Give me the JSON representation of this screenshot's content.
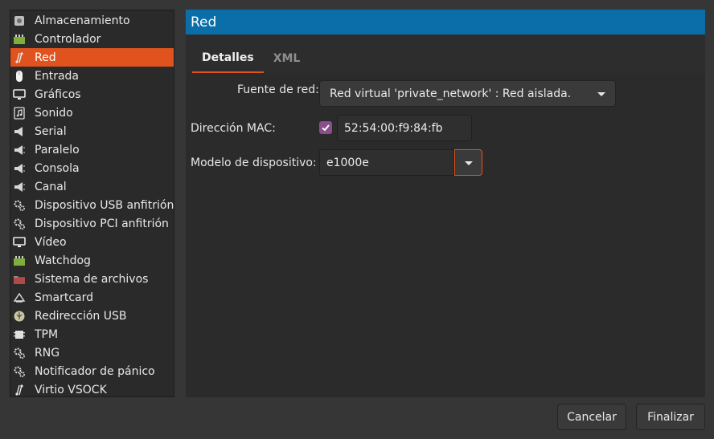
{
  "sidebar": {
    "items": [
      {
        "label": "Almacenamiento",
        "icon": "disk-icon"
      },
      {
        "label": "Controlador",
        "icon": "chip-icon"
      },
      {
        "label": "Red",
        "icon": "network-icon",
        "selected": true
      },
      {
        "label": "Entrada",
        "icon": "mouse-icon"
      },
      {
        "label": "Gráficos",
        "icon": "monitor-icon"
      },
      {
        "label": "Sonido",
        "icon": "sound-icon"
      },
      {
        "label": "Serial",
        "icon": "serial-icon"
      },
      {
        "label": "Paralelo",
        "icon": "port-icon"
      },
      {
        "label": "Consola",
        "icon": "port-icon"
      },
      {
        "label": "Canal",
        "icon": "port-icon"
      },
      {
        "label": "Dispositivo USB anfitrión",
        "icon": "gears-icon"
      },
      {
        "label": "Dispositivo PCI anfitrión",
        "icon": "gears-icon"
      },
      {
        "label": "Vídeo",
        "icon": "monitor-icon"
      },
      {
        "label": "Watchdog",
        "icon": "chip-icon"
      },
      {
        "label": "Sistema de archivos",
        "icon": "folder-icon"
      },
      {
        "label": "Smartcard",
        "icon": "smartcard-icon"
      },
      {
        "label": "Redirección USB",
        "icon": "usb-icon"
      },
      {
        "label": "TPM",
        "icon": "tpm-icon"
      },
      {
        "label": "RNG",
        "icon": "gears-icon"
      },
      {
        "label": "Notificador de pánico",
        "icon": "gears-icon"
      },
      {
        "label": "Virtio VSOCK",
        "icon": "network-icon"
      }
    ]
  },
  "header": {
    "title": "Red"
  },
  "tabs": [
    {
      "label": "Detalles",
      "active": true
    },
    {
      "label": "XML",
      "active": false
    }
  ],
  "form": {
    "source_label": "Fuente de red:",
    "source_value": "Red virtual 'private_network' : Red aislada.",
    "mac_label": "Dirección MAC:",
    "mac_checked": true,
    "mac_value": "52:54:00:f9:84:fb",
    "model_label": "Modelo de dispositivo:",
    "model_value": "e1000e"
  },
  "footer": {
    "cancel_label": "Cancelar",
    "finish_label": "Finalizar"
  },
  "colors": {
    "accent": "#e0531e",
    "header": "#0b6ea8",
    "checkbox": "#8a4e8a"
  }
}
